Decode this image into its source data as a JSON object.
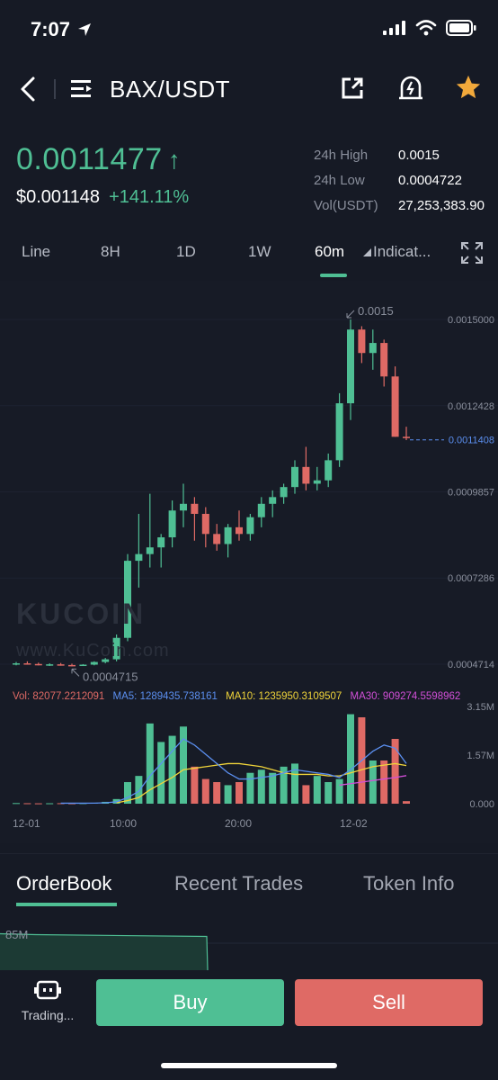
{
  "status_bar": {
    "time": "7:07"
  },
  "nav": {
    "pair": "BAX/USDT"
  },
  "price": {
    "last": "0.0011477",
    "arrow": "↑",
    "usd": "$0.001148",
    "change": "+141.11%"
  },
  "stats": [
    {
      "label": "24h High",
      "value": "0.0015"
    },
    {
      "label": "24h Low",
      "value": "0.0004722"
    },
    {
      "label": "Vol(USDT)",
      "value": "27,253,383.90"
    }
  ],
  "chart_tabs": {
    "line": "Line",
    "h8": "8H",
    "d1": "1D",
    "w1": "1W",
    "m60": "60m",
    "indicators": "Indicat..."
  },
  "colors": {
    "up": "#4fbf94",
    "down": "#df6a65",
    "ma5": "#5b8ff0",
    "ma10": "#f0d43a",
    "ma30": "#d24fd8",
    "vol_label": "#df6a65"
  },
  "chart_data": {
    "type": "candlestick",
    "price_axis": [
      "0.0015000",
      "0.0012428",
      "0.0011408",
      "0.0009857",
      "0.0007286",
      "0.0004714"
    ],
    "current_price_label": "0.0011408",
    "current_price": 0.0011408,
    "high_annotation": "0.0015",
    "low_annotation": "0.0004715",
    "ylim": [
      0.0004714,
      0.0015
    ],
    "time_labels": [
      "12-01",
      "10:00",
      "20:00",
      "12-02"
    ],
    "candles": [
      {
        "o": 0.000472,
        "h": 0.000478,
        "l": 0.000468,
        "c": 0.000474
      },
      {
        "o": 0.000474,
        "h": 0.00048,
        "l": 0.00047,
        "c": 0.000472
      },
      {
        "o": 0.000472,
        "h": 0.000476,
        "l": 0.000468,
        "c": 0.00047
      },
      {
        "o": 0.00047,
        "h": 0.000474,
        "l": 0.000466,
        "c": 0.000471
      },
      {
        "o": 0.000471,
        "h": 0.000475,
        "l": 0.000467,
        "c": 0.000469
      },
      {
        "o": 0.000469,
        "h": 0.000473,
        "l": 0.000465,
        "c": 0.000468
      },
      {
        "o": 0.000468,
        "h": 0.00047,
        "l": 0.0004715,
        "c": 0.00047
      },
      {
        "o": 0.00047,
        "h": 0.00048,
        "l": 0.000468,
        "c": 0.000478
      },
      {
        "o": 0.000478,
        "h": 0.00049,
        "l": 0.000474,
        "c": 0.000486
      },
      {
        "o": 0.000486,
        "h": 0.00056,
        "l": 0.00048,
        "c": 0.00055
      },
      {
        "o": 0.00055,
        "h": 0.0008,
        "l": 0.00054,
        "c": 0.00078
      },
      {
        "o": 0.00078,
        "h": 0.00092,
        "l": 0.0007,
        "c": 0.0008
      },
      {
        "o": 0.0008,
        "h": 0.00098,
        "l": 0.00076,
        "c": 0.00082
      },
      {
        "o": 0.00082,
        "h": 0.00086,
        "l": 0.00076,
        "c": 0.00085
      },
      {
        "o": 0.00085,
        "h": 0.00096,
        "l": 0.00082,
        "c": 0.00093
      },
      {
        "o": 0.00093,
        "h": 0.00101,
        "l": 0.00088,
        "c": 0.00095
      },
      {
        "o": 0.00095,
        "h": 0.00097,
        "l": 0.00084,
        "c": 0.00092
      },
      {
        "o": 0.00092,
        "h": 0.00094,
        "l": 0.00082,
        "c": 0.00086
      },
      {
        "o": 0.00086,
        "h": 0.00089,
        "l": 0.00081,
        "c": 0.00083
      },
      {
        "o": 0.00083,
        "h": 0.00089,
        "l": 0.00079,
        "c": 0.00088
      },
      {
        "o": 0.00088,
        "h": 0.00093,
        "l": 0.00084,
        "c": 0.00086
      },
      {
        "o": 0.00086,
        "h": 0.00092,
        "l": 0.00084,
        "c": 0.00091
      },
      {
        "o": 0.00091,
        "h": 0.00097,
        "l": 0.00088,
        "c": 0.00095
      },
      {
        "o": 0.00095,
        "h": 0.00099,
        "l": 0.00091,
        "c": 0.00097
      },
      {
        "o": 0.00097,
        "h": 0.00101,
        "l": 0.00095,
        "c": 0.001
      },
      {
        "o": 0.001,
        "h": 0.00108,
        "l": 0.00098,
        "c": 0.00106
      },
      {
        "o": 0.00106,
        "h": 0.00112,
        "l": 0.00099,
        "c": 0.00101
      },
      {
        "o": 0.00101,
        "h": 0.00106,
        "l": 0.00099,
        "c": 0.00102
      },
      {
        "o": 0.00102,
        "h": 0.0011,
        "l": 0.001,
        "c": 0.00108
      },
      {
        "o": 0.00108,
        "h": 0.00128,
        "l": 0.00106,
        "c": 0.00125
      },
      {
        "o": 0.00125,
        "h": 0.0015,
        "l": 0.0012,
        "c": 0.00147
      },
      {
        "o": 0.00147,
        "h": 0.00148,
        "l": 0.00137,
        "c": 0.0014
      },
      {
        "o": 0.0014,
        "h": 0.00147,
        "l": 0.00135,
        "c": 0.00143
      },
      {
        "o": 0.00143,
        "h": 0.00144,
        "l": 0.0013,
        "c": 0.00133
      },
      {
        "o": 0.00133,
        "h": 0.00136,
        "l": 0.00115,
        "c": 0.00115
      },
      {
        "o": 0.00115,
        "h": 0.00118,
        "l": 0.00114,
        "c": 0.001148
      }
    ],
    "volume": {
      "axis": [
        "3.15M",
        "1.57M",
        "0.000"
      ],
      "ylim": [
        0,
        3150000
      ],
      "labels": {
        "vol": "Vol: 82077.2212091",
        "ma5": "MA5: 1289435.738161",
        "ma10": "MA10: 1235950.3109507",
        "ma30": "MA30: 909274.5598962"
      },
      "values": [
        20000,
        15000,
        12000,
        14000,
        16000,
        13000,
        18000,
        30000,
        60000,
        150000,
        700000,
        900000,
        2600000,
        2000000,
        2200000,
        2500000,
        1200000,
        800000,
        700000,
        600000,
        700000,
        1000000,
        1100000,
        1000000,
        1200000,
        1300000,
        600000,
        900000,
        700000,
        800000,
        2900000,
        2800000,
        1400000,
        1400000,
        2100000,
        82077
      ],
      "ma5": [
        null,
        null,
        null,
        null,
        16000,
        16000,
        17000,
        18000,
        30000,
        60000,
        200000,
        400000,
        900000,
        1300000,
        1700000,
        2100000,
        1900000,
        1600000,
        1300000,
        1000000,
        800000,
        800000,
        850000,
        900000,
        1000000,
        1100000,
        1050000,
        1000000,
        950000,
        850000,
        1100000,
        1400000,
        1700000,
        1900000,
        1800000,
        1300000
      ],
      "ma10": [
        null,
        null,
        null,
        null,
        null,
        null,
        null,
        null,
        null,
        30000,
        100000,
        200000,
        450000,
        650000,
        850000,
        1100000,
        1150000,
        1200000,
        1250000,
        1300000,
        1300000,
        1250000,
        1200000,
        1100000,
        1000000,
        950000,
        950000,
        950000,
        900000,
        900000,
        1000000,
        1100000,
        1200000,
        1250000,
        1300000,
        1235950
      ],
      "ma30": [
        null,
        null,
        null,
        null,
        null,
        null,
        null,
        null,
        null,
        null,
        null,
        null,
        null,
        null,
        null,
        null,
        null,
        null,
        null,
        null,
        null,
        null,
        null,
        null,
        null,
        null,
        null,
        null,
        null,
        600000,
        650000,
        700000,
        750000,
        800000,
        850000,
        909274
      ]
    }
  },
  "watermark": {
    "brand": "KUCOIN",
    "site": "www.KuCoin.com"
  },
  "bottom_tabs": {
    "orderbook": "OrderBook",
    "trades": "Recent Trades",
    "info": "Token Info"
  },
  "orderbook": {
    "depth_label": "85M",
    "depth_level": 0.92
  },
  "footer": {
    "trading": "Trading...",
    "buy": "Buy",
    "sell": "Sell"
  }
}
